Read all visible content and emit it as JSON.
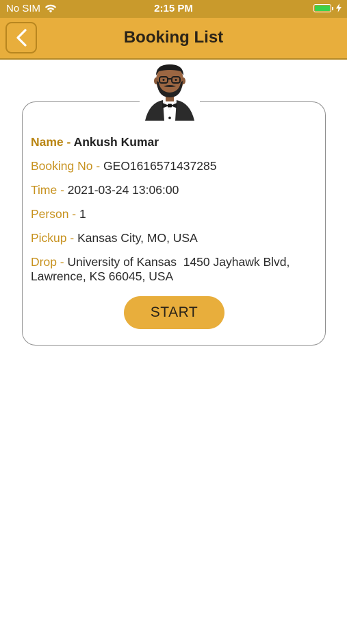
{
  "status_bar": {
    "carrier": "No SIM",
    "time": "2:15 PM",
    "battery_level": 1.0
  },
  "header": {
    "title": "Booking List",
    "back_icon": "chevron-left-icon"
  },
  "booking": {
    "avatar_icon": "chauffeur-avatar-icon",
    "name_label": "Name - ",
    "name": "Ankush Kumar",
    "booking_no_label": "Booking No - ",
    "booking_no": "GEO1616571437285",
    "time_label": "Time - ",
    "time": "2021-03-24 13:06:00",
    "person_label": "Person - ",
    "person": "1",
    "pickup_label": "Pickup - ",
    "pickup": "Kansas City, MO, USA",
    "drop_label": "Drop - ",
    "drop": "University of Kansas  1450 Jayhawk Blvd, Lawrence, KS 66045, USA",
    "start_label": "START"
  },
  "colors": {
    "status_bar": "#c99a2c",
    "nav_bar": "#e8ae3c",
    "label": "#c7921f",
    "button": "#e8ae3c",
    "battery": "#3bd14a"
  }
}
